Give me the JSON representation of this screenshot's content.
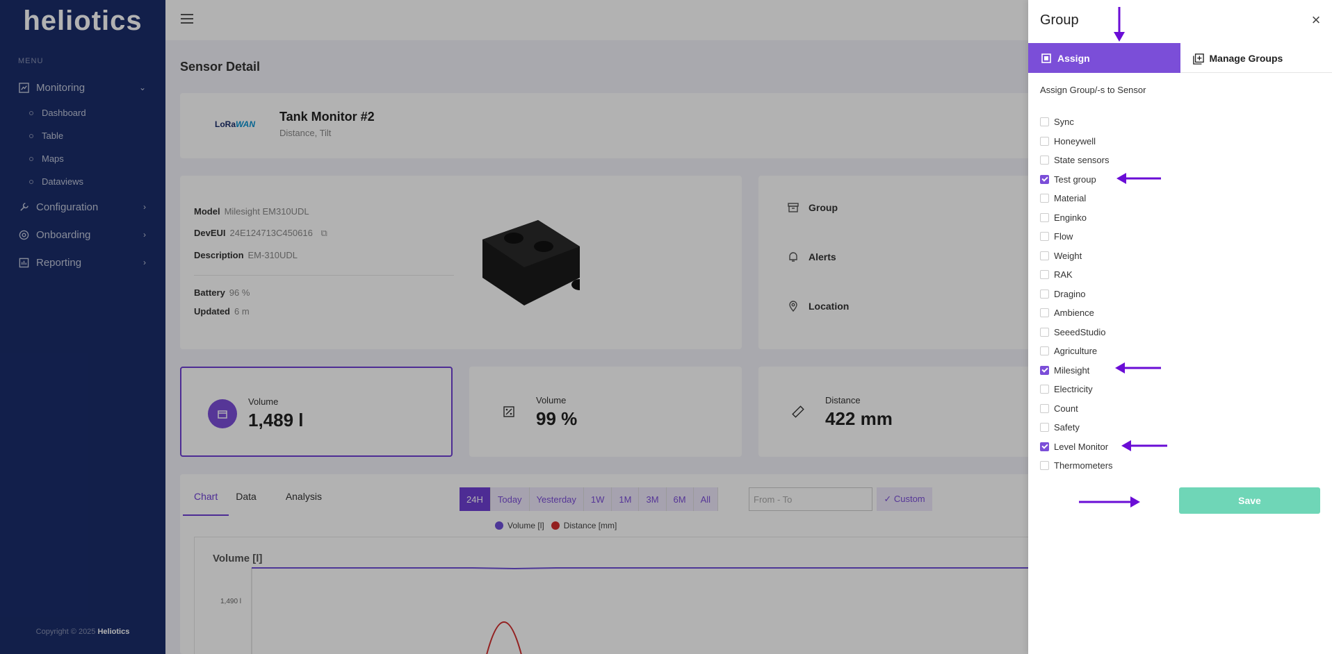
{
  "sidebar": {
    "logo": "heliotics",
    "menu_title": "MENU",
    "items": [
      {
        "label": "Monitoring",
        "icon": "chart-icon"
      },
      {
        "label": "Configuration",
        "icon": "wrench-icon"
      },
      {
        "label": "Onboarding",
        "icon": "target-icon"
      },
      {
        "label": "Reporting",
        "icon": "report-icon"
      }
    ],
    "subitems": [
      "Dashboard",
      "Table",
      "Maps",
      "Dataviews"
    ],
    "copyright_prefix": "Copyright © 2025",
    "copyright_brand": "Heliotics"
  },
  "page": {
    "title": "Sensor Detail",
    "lora_a": "LoRa",
    "lora_b": "WAN",
    "sensor_name": "Tank Monitor #2",
    "sensor_types": "Distance, Tilt"
  },
  "info": {
    "model_label": "Model",
    "model": "Milesight EM310UDL",
    "deveui_label": "DevEUI",
    "deveui": "24E124713C450616",
    "desc_label": "Description",
    "desc": "EM-310UDL",
    "battery_label": "Battery",
    "battery": "96 %",
    "updated_label": "Updated",
    "updated": "6 m"
  },
  "side": {
    "group": "Group",
    "alerts": "Alerts",
    "location": "Location"
  },
  "metrics": [
    {
      "label": "Volume",
      "value": "1,489 l"
    },
    {
      "label": "Volume",
      "value": "99 %"
    },
    {
      "label": "Distance",
      "value": "422 mm"
    }
  ],
  "chart": {
    "tabs": [
      "Chart",
      "Data",
      "Analysis"
    ],
    "ranges": [
      "24H",
      "Today",
      "Yesterday",
      "1W",
      "1M",
      "3M",
      "6M",
      "All"
    ],
    "from_to_placeholder": "From - To",
    "custom": "✓ Custom",
    "title": "Volume [l]",
    "legend": [
      "Volume [l]",
      "Distance [mm]"
    ],
    "ytick": "1,490 l"
  },
  "chart_data": {
    "type": "line",
    "title": "Volume [l]",
    "series": [
      {
        "name": "Volume [l]"
      },
      {
        "name": "Distance [mm]"
      }
    ],
    "legend_position": "top-center"
  },
  "drawer": {
    "title": "Group",
    "tab_assign": "Assign",
    "tab_manage": "Manage Groups",
    "assign_label": "Assign Group/-s to Sensor",
    "groups": [
      {
        "label": "Sync",
        "checked": false
      },
      {
        "label": "Honeywell",
        "checked": false
      },
      {
        "label": "State sensors",
        "checked": false
      },
      {
        "label": "Test group",
        "checked": true
      },
      {
        "label": "Material",
        "checked": false
      },
      {
        "label": "Enginko",
        "checked": false
      },
      {
        "label": "Flow",
        "checked": false
      },
      {
        "label": "Weight",
        "checked": false
      },
      {
        "label": "RAK",
        "checked": false
      },
      {
        "label": "Dragino",
        "checked": false
      },
      {
        "label": "Ambience",
        "checked": false
      },
      {
        "label": "SeeedStudio",
        "checked": false
      },
      {
        "label": "Agriculture",
        "checked": false
      },
      {
        "label": "Milesight",
        "checked": true
      },
      {
        "label": "Electricity",
        "checked": false
      },
      {
        "label": "Count",
        "checked": false
      },
      {
        "label": "Safety",
        "checked": false
      },
      {
        "label": "Level Monitor",
        "checked": true
      },
      {
        "label": "Thermometers",
        "checked": false
      }
    ],
    "save": "Save"
  },
  "colors": {
    "accent": "#7b4ed8",
    "save": "#6fd6b7",
    "sidebar": "#1a2d6b",
    "arrow": "#6a0dd6"
  }
}
